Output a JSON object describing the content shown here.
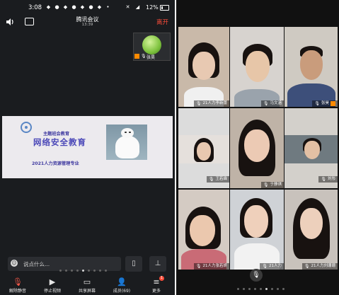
{
  "status_bar": {
    "time": "3:08",
    "battery": "12%"
  },
  "header": {
    "title": "腾讯会议",
    "clock": "13:39",
    "leave_label": "离开"
  },
  "self_thumb": {
    "name": "张昊"
  },
  "slide": {
    "line1": "主题班会教育",
    "line2": "网络安全教育",
    "line3": "2021人力资源管理专业"
  },
  "chat": {
    "placeholder": "说点什么..."
  },
  "toolbar": [
    {
      "label": "解除静音",
      "icon": "mic-muted-icon"
    },
    {
      "label": "停止视频",
      "icon": "video-camera-icon"
    },
    {
      "label": "共享屏幕",
      "icon": "share-screen-icon"
    },
    {
      "label": "成员(69)",
      "icon": "members-icon"
    },
    {
      "label": "更多",
      "icon": "menu-icon",
      "badge": "1"
    }
  ],
  "participants": [
    {
      "name": "21人力李新蕾"
    },
    {
      "name": "马文涵"
    },
    {
      "name": "张昊"
    },
    {
      "name": "王若霖"
    },
    {
      "name": "于静琪"
    },
    {
      "name": "刘彤"
    },
    {
      "name": "21人力张若妍"
    },
    {
      "name": "21人力"
    },
    {
      "name": "21人力刘珊珊"
    }
  ],
  "colors": {
    "leave": "#ff4d3a",
    "accent_orange": "#ff8a00",
    "slide_text": "#4b48b8"
  }
}
